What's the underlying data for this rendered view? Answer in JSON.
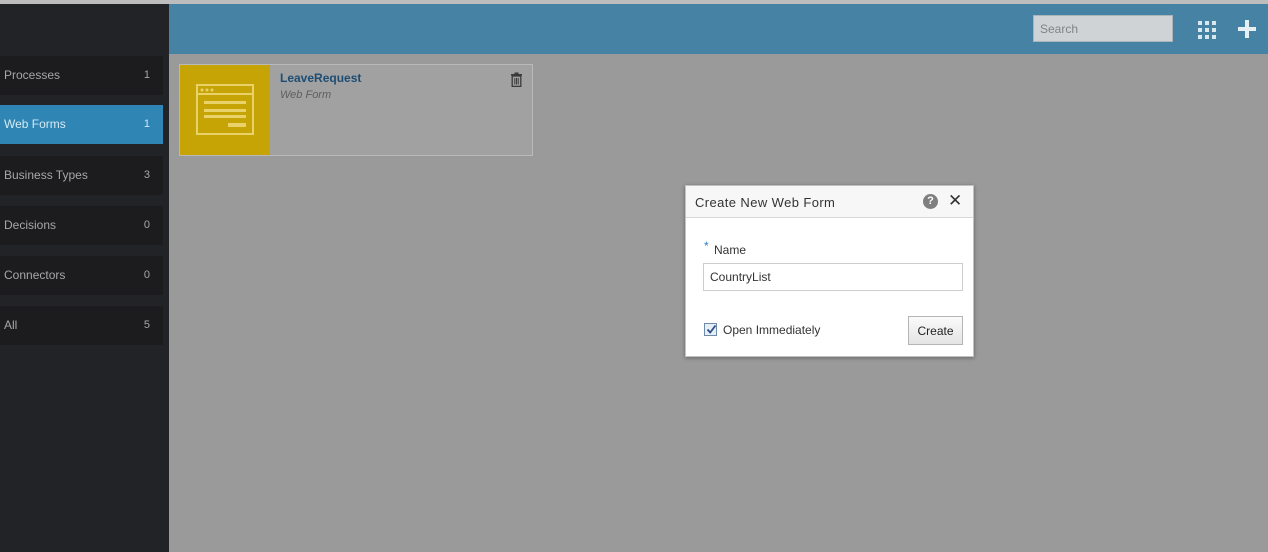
{
  "sidebar": {
    "items": [
      {
        "label": "Processes",
        "count": "1",
        "active": false
      },
      {
        "label": "Web Forms",
        "count": "1",
        "active": true
      },
      {
        "label": "Business Types",
        "count": "3",
        "active": false
      },
      {
        "label": "Decisions",
        "count": "0",
        "active": false
      },
      {
        "label": "Connectors",
        "count": "0",
        "active": false
      },
      {
        "label": "All",
        "count": "5",
        "active": false
      }
    ]
  },
  "header": {
    "search_placeholder": "Search",
    "grid_icon": "grid-view-icon",
    "add_icon": "plus-icon"
  },
  "card": {
    "title": "LeaveRequest",
    "subtitle": "Web Form",
    "thumb_icon": "web-form-icon",
    "delete_icon": "trash-icon"
  },
  "dialog": {
    "title": "Create New Web Form",
    "help_glyph": "?",
    "close_glyph": "✕",
    "required_mark": "*",
    "name_label": "Name",
    "name_value": "CountryList",
    "open_immediately_label": "Open Immediately",
    "open_immediately_checked": true,
    "create_label": "Create"
  },
  "colors": {
    "header": "#4682a4",
    "sidebar": "#222327",
    "active_item": "#2f86b4",
    "card_thumb": "#c7a406"
  }
}
